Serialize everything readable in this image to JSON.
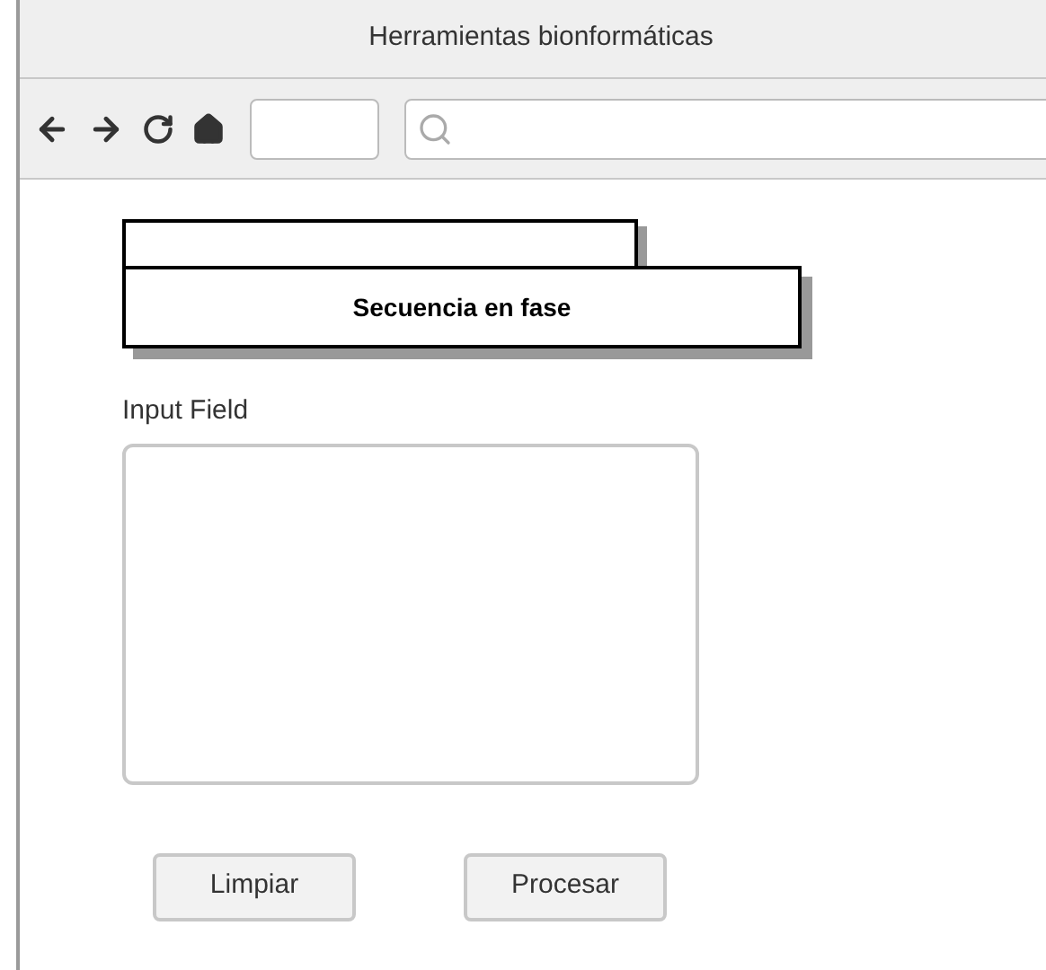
{
  "window": {
    "title": "Herramientas bionformáticas"
  },
  "card": {
    "title": "Secuencia en fase"
  },
  "input": {
    "label": "Input Field"
  },
  "buttons": [
    "Limpiar",
    "Procesar"
  ]
}
